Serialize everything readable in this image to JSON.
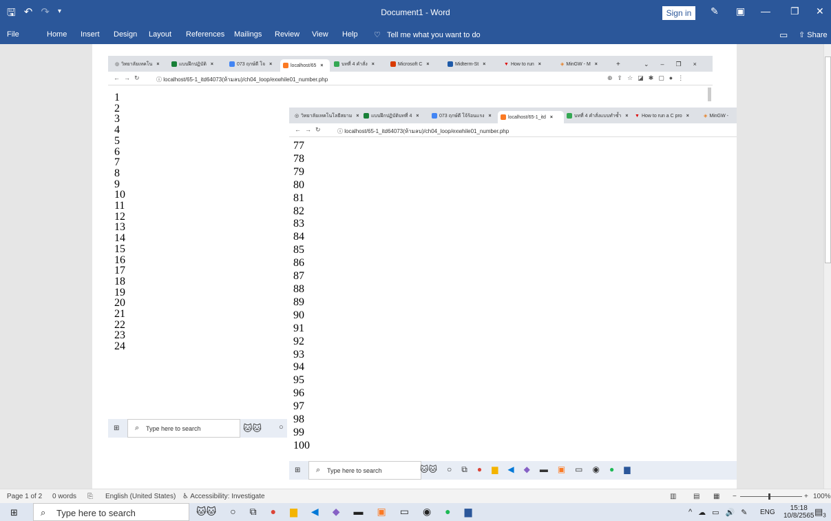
{
  "word": {
    "title": "Document1  -  Word",
    "sign_in": "Sign in",
    "tabs": [
      "File",
      "Home",
      "Insert",
      "Design",
      "Layout",
      "References",
      "Mailings",
      "Review",
      "View",
      "Help"
    ],
    "tell_me": "Tell me what you want to do",
    "share": "Share",
    "status": {
      "page": "Page 1 of 2",
      "words": "0 words",
      "language": "English (United States)",
      "accessibility": "Accessibility: Investigate",
      "zoom": "100%"
    }
  },
  "browser1": {
    "tabs": [
      "วิทยาลัยเทคโน",
      "แบบฝึกปฏิบัติ",
      "073 ฤกษ์ดี โจ",
      "localhost/65",
      "บทที่ 4 คำสั่ง",
      "Microsoft C",
      "Midterm-St",
      "How to run",
      "MinGW - M"
    ],
    "new_tab": "+",
    "url": "localhost/65-1_itd64073(ห้ามลบ)/ch04_loop/exwhile01_number.php",
    "numbers": [
      "1",
      "2",
      "3",
      "4",
      "5",
      "6",
      "7",
      "8",
      "9",
      "10",
      "11",
      "12",
      "13",
      "14",
      "15",
      "16",
      "17",
      "18",
      "19",
      "20",
      "21",
      "22",
      "23",
      "24"
    ],
    "search_placeholder": "Type here to search"
  },
  "browser2": {
    "tabs": [
      "วิทยาลัยเทคโนโลยีสยาม",
      "แบบฝึกปฏิบัติบทที่ 4",
      "073 ฤกษ์ดี โจ้ร้อนแรง",
      "localhost/65-1_itd",
      "บทที่ 4 คำสั่งแบบทำซ้ำ",
      "How to run a C pro",
      "MinGW -"
    ],
    "url": "localhost/65-1_itd64073(ห้ามลบ)/ch04_loop/exwhile01_number.php",
    "numbers": [
      "77",
      "78",
      "79",
      "80",
      "81",
      "82",
      "83",
      "84",
      "85",
      "86",
      "87",
      "88",
      "89",
      "90",
      "91",
      "92",
      "93",
      "94",
      "95",
      "96",
      "97",
      "98",
      "99",
      "100"
    ],
    "search_placeholder": "Type here to search"
  },
  "taskbar": {
    "search_placeholder": "Type here to search",
    "language": "ENG",
    "time": "15:18",
    "date": "10/8/2565",
    "notification_count": "3"
  },
  "colors": {
    "word_blue": "#2b579a",
    "taskbar": "#dfe6f1"
  }
}
